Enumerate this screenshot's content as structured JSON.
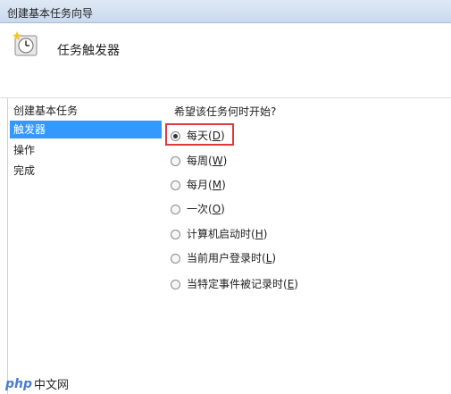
{
  "window": {
    "title": "创建基本任务向导"
  },
  "header": {
    "title": "任务触发器",
    "icon": "clock-icon"
  },
  "sidebar": {
    "items": [
      {
        "label": "创建基本任务",
        "active": false
      },
      {
        "label": "触发器",
        "active": true
      },
      {
        "label": "操作",
        "active": false
      },
      {
        "label": "完成",
        "active": false
      }
    ]
  },
  "content": {
    "question": "希望该任务何时开始?",
    "options": [
      {
        "text": "每天",
        "key": "D",
        "checked": true
      },
      {
        "text": "每周",
        "key": "W",
        "checked": false
      },
      {
        "text": "每月",
        "key": "M",
        "checked": false
      },
      {
        "text": "一次",
        "key": "O",
        "checked": false
      },
      {
        "text": "计算机启动时",
        "key": "H",
        "checked": false
      },
      {
        "text": "当前用户登录时",
        "key": "L",
        "checked": false
      },
      {
        "text": "当特定事件被记录时",
        "key": "E",
        "checked": false
      }
    ]
  },
  "watermark": {
    "logo": "php",
    "text": "中文网"
  },
  "colors": {
    "selection": "#3399ff",
    "highlight_border": "#e03a3a"
  }
}
